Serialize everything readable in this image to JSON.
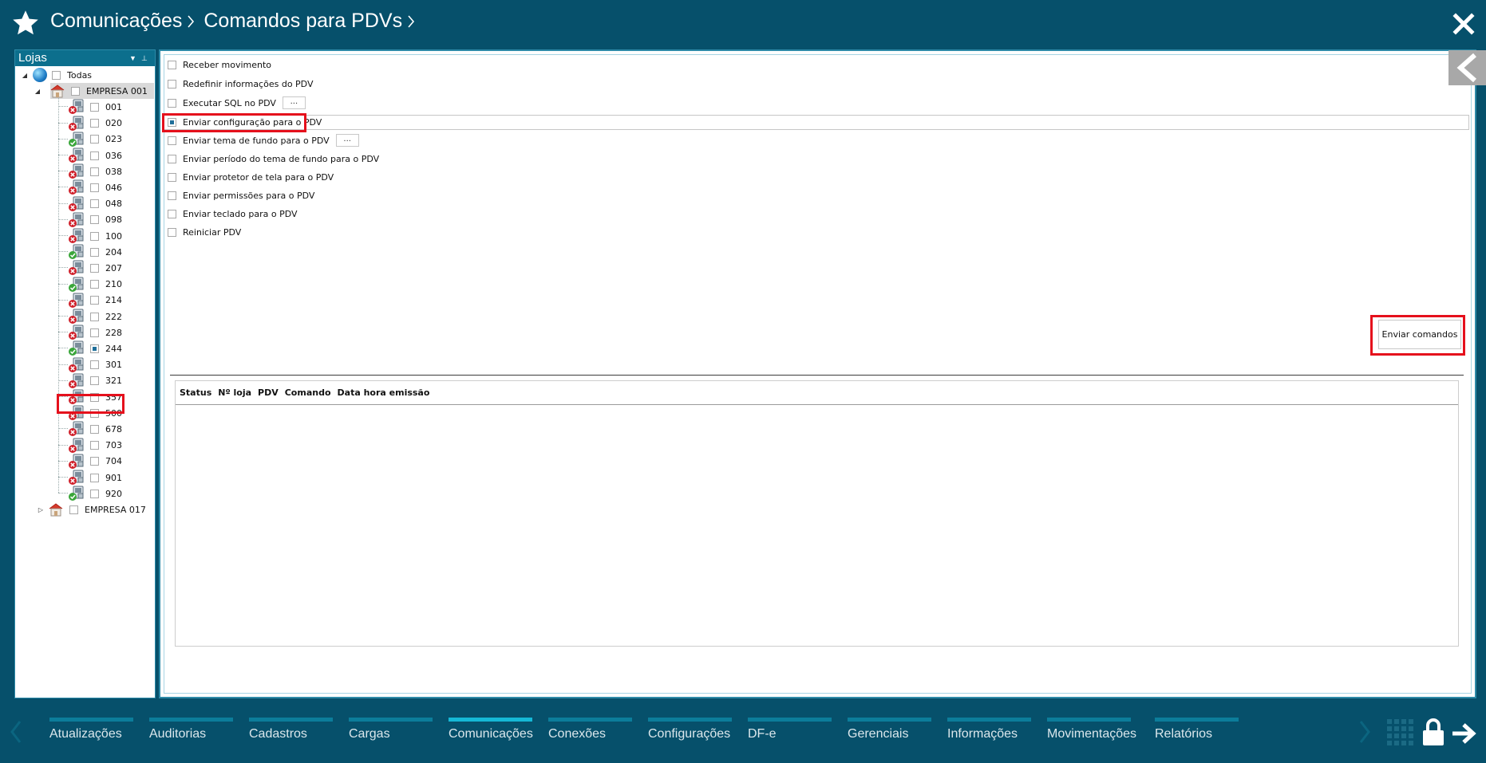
{
  "header": {
    "breadcrumb": [
      "Comunicações",
      "Comandos para PDVs"
    ]
  },
  "tree": {
    "title": "Lojas",
    "root_label": "Todas",
    "companies": [
      {
        "label": "EMPRESA 001",
        "expanded": true,
        "stores": [
          {
            "label": "001",
            "status": "error",
            "checked": false
          },
          {
            "label": "020",
            "status": "error",
            "checked": false
          },
          {
            "label": "023",
            "status": "ok",
            "checked": false
          },
          {
            "label": "036",
            "status": "error",
            "checked": false
          },
          {
            "label": "038",
            "status": "error",
            "checked": false
          },
          {
            "label": "046",
            "status": "error",
            "checked": false
          },
          {
            "label": "048",
            "status": "error",
            "checked": false
          },
          {
            "label": "098",
            "status": "error",
            "checked": false
          },
          {
            "label": "100",
            "status": "error",
            "checked": false
          },
          {
            "label": "204",
            "status": "ok",
            "checked": false
          },
          {
            "label": "207",
            "status": "error",
            "checked": false
          },
          {
            "label": "210",
            "status": "ok",
            "checked": false
          },
          {
            "label": "214",
            "status": "error",
            "checked": false
          },
          {
            "label": "222",
            "status": "error",
            "checked": false
          },
          {
            "label": "228",
            "status": "error",
            "checked": false
          },
          {
            "label": "244",
            "status": "ok",
            "checked": true
          },
          {
            "label": "301",
            "status": "error",
            "checked": false
          },
          {
            "label": "321",
            "status": "error",
            "checked": false
          },
          {
            "label": "357",
            "status": "error",
            "checked": false
          },
          {
            "label": "500",
            "status": "error",
            "checked": false
          },
          {
            "label": "678",
            "status": "error",
            "checked": false
          },
          {
            "label": "703",
            "status": "error",
            "checked": false
          },
          {
            "label": "704",
            "status": "error",
            "checked": false
          },
          {
            "label": "901",
            "status": "error",
            "checked": false
          },
          {
            "label": "920",
            "status": "ok",
            "checked": false
          }
        ]
      },
      {
        "label": "EMPRESA 017",
        "expanded": false,
        "stores": []
      }
    ]
  },
  "commands": [
    {
      "label": "Receber movimento",
      "checked": false,
      "has_dots": false
    },
    {
      "label": "Redefinir informações do PDV",
      "checked": false,
      "has_dots": false
    },
    {
      "label": "Executar SQL no PDV",
      "checked": false,
      "has_dots": true
    },
    {
      "label": "Enviar configuração para o PDV",
      "checked": true,
      "has_dots": false
    },
    {
      "label": "Enviar tema de fundo para o PDV",
      "checked": false,
      "has_dots": true
    },
    {
      "label": "Enviar período do tema de fundo para o PDV",
      "checked": false,
      "has_dots": false
    },
    {
      "label": "Enviar protetor de tela para o PDV",
      "checked": false,
      "has_dots": false
    },
    {
      "label": "Enviar permissões para o PDV",
      "checked": false,
      "has_dots": false
    },
    {
      "label": "Enviar teclado para o PDV",
      "checked": false,
      "has_dots": false
    },
    {
      "label": "Reiniciar PDV",
      "checked": false,
      "has_dots": false
    }
  ],
  "dots_label": "...",
  "send_button": "Enviar comandos",
  "grid": {
    "columns": [
      "Status",
      "Nº loja",
      "PDV",
      "Comando",
      "Data hora emissão"
    ]
  },
  "bottom_nav": {
    "items": [
      {
        "label": "Atualizações",
        "active": false
      },
      {
        "label": "Auditorias",
        "active": false
      },
      {
        "label": "Cadastros",
        "active": false
      },
      {
        "label": "Cargas",
        "active": false
      },
      {
        "label": "Comunicações",
        "active": true
      },
      {
        "label": "Conexões",
        "active": false
      },
      {
        "label": "Configurações",
        "active": false
      },
      {
        "label": "DF-e",
        "active": false
      },
      {
        "label": "Gerenciais",
        "active": false
      },
      {
        "label": "Informações",
        "active": false
      },
      {
        "label": "Movimentações",
        "active": false
      },
      {
        "label": "Relatórios",
        "active": false
      }
    ]
  },
  "colors": {
    "background": "#06506b",
    "accent": "#0c7d9a",
    "accent_active": "#15b8d6",
    "highlight_red": "#e5101c"
  }
}
